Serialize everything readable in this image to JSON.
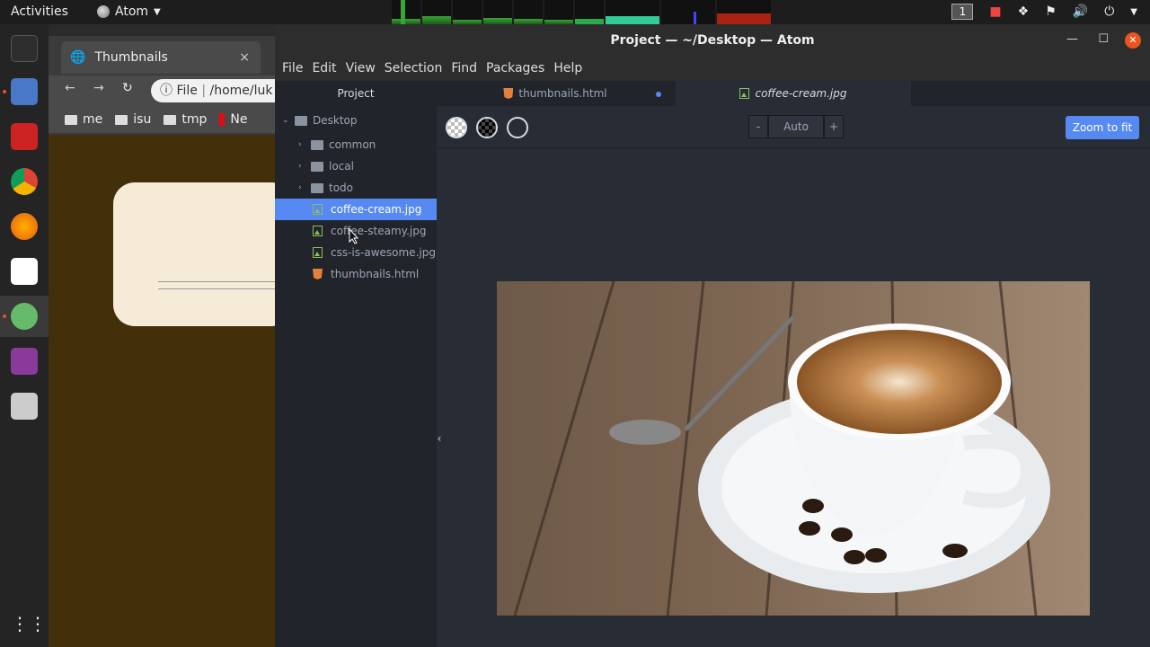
{
  "topbar": {
    "activities": "Activities",
    "app_name": "Atom",
    "workspace": "1"
  },
  "chrome": {
    "tab_title": "Thumbnails",
    "tab_close": "×",
    "url_scheme": "File",
    "url": "/home/luk",
    "bookmarks": [
      "me",
      "isu",
      "tmp",
      "Ne"
    ]
  },
  "atom": {
    "title": "Project — ~/Desktop — Atom",
    "menu": [
      "File",
      "Edit",
      "View",
      "Selection",
      "Find",
      "Packages",
      "Help"
    ],
    "tree": {
      "header": "Project",
      "root": "Desktop",
      "folders": [
        "common",
        "local",
        "todo"
      ],
      "files": [
        {
          "name": "coffee-cream.jpg",
          "type": "image",
          "selected": true
        },
        {
          "name": "coffee-steamy.jpg",
          "type": "image",
          "selected": false
        },
        {
          "name": "css-is-awesome.jpg",
          "type": "image",
          "selected": false
        },
        {
          "name": "thumbnails.html",
          "type": "html",
          "selected": false
        }
      ]
    },
    "tabs": [
      {
        "label": "thumbnails.html",
        "modified": true
      },
      {
        "label": "coffee-cream.jpg",
        "active": true
      }
    ],
    "image_view": {
      "zoom_out": "-",
      "zoom_level": "Auto",
      "zoom_in": "+",
      "zoom_to_fit": "Zoom to fit"
    }
  },
  "colors": {
    "accent": "#568af2",
    "ubuntu_orange": "#e95420",
    "chrome_page_bg": "#432f0a"
  }
}
